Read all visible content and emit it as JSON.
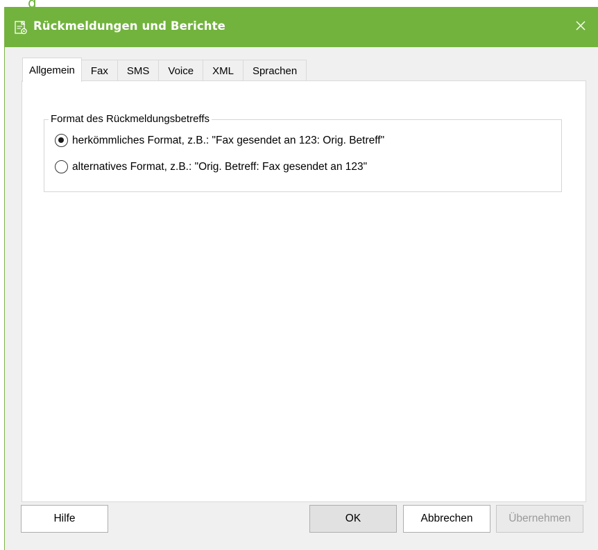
{
  "window": {
    "title": "Rückmeldungen und Berichte",
    "accent_color": "#72b33d",
    "icons": {
      "app": "document-settings-icon",
      "close": "close-icon"
    }
  },
  "tabs": [
    {
      "label": "Allgemein",
      "active": true
    },
    {
      "label": "Fax",
      "active": false
    },
    {
      "label": "SMS",
      "active": false
    },
    {
      "label": "Voice",
      "active": false
    },
    {
      "label": "XML",
      "active": false
    },
    {
      "label": "Sprachen",
      "active": false
    }
  ],
  "group": {
    "legend": "Format des Rückmeldungsbetreffs",
    "options": [
      {
        "label": "herkömmliches Format, z.B.: \"Fax gesendet an 123: Orig. Betreff\"",
        "checked": true
      },
      {
        "label": "alternatives Format, z.B.: \"Orig. Betreff: Fax gesendet an 123\"",
        "checked": false
      }
    ]
  },
  "buttons": {
    "help": "Hilfe",
    "ok": "OK",
    "cancel": "Abbrechen",
    "apply": "Übernehmen"
  }
}
